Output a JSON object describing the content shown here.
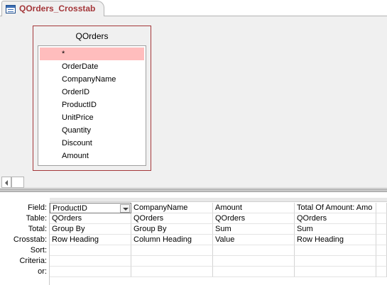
{
  "tab": {
    "label": "QOrders_Crosstab",
    "icon": "crosstab-query-icon"
  },
  "table": {
    "title": "QOrders",
    "fields": [
      "*",
      "OrderDate",
      "CompanyName",
      "OrderID",
      "ProductID",
      "UnitPrice",
      "Quantity",
      "Discount",
      "Amount"
    ]
  },
  "grid": {
    "row_labels": [
      "Field:",
      "Table:",
      "Total:",
      "Crosstab:",
      "Sort:",
      "Criteria:",
      "or:"
    ],
    "columns": [
      {
        "field": "ProductID",
        "table": "QOrders",
        "total": "Group By",
        "crosstab": "Row Heading",
        "sort": "",
        "criteria": "",
        "or": ""
      },
      {
        "field": "CompanyName",
        "table": "QOrders",
        "total": "Group By",
        "crosstab": "Column Heading",
        "sort": "",
        "criteria": "",
        "or": ""
      },
      {
        "field": "Amount",
        "table": "QOrders",
        "total": "Sum",
        "crosstab": "Value",
        "sort": "",
        "criteria": "",
        "or": ""
      },
      {
        "field": "Total Of Amount: Amo",
        "table": "QOrders",
        "total": "Sum",
        "crosstab": "Row Heading",
        "sort": "",
        "criteria": "",
        "or": ""
      }
    ]
  },
  "colors": {
    "accent": "#a4373a",
    "selected_field": "#ffbdbd"
  }
}
